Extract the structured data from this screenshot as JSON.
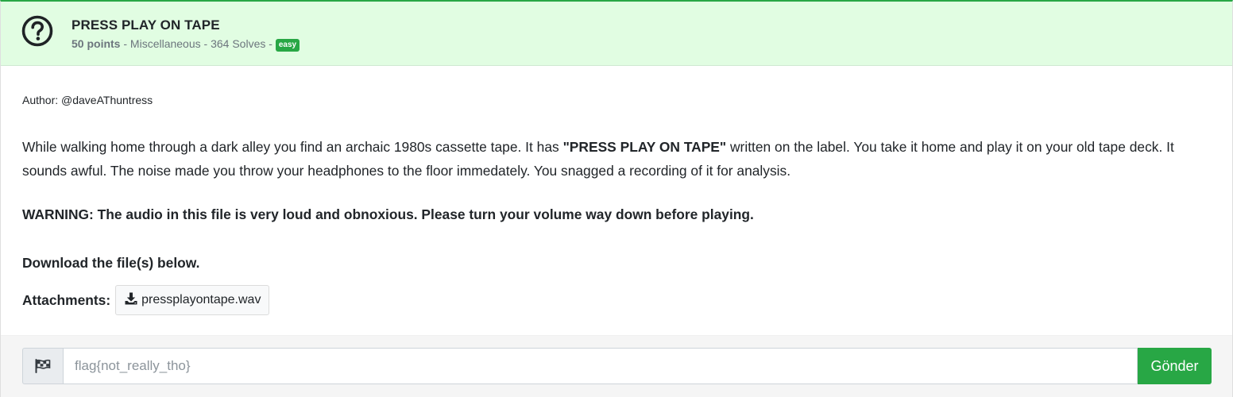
{
  "challenge": {
    "title": "PRESS PLAY ON TAPE",
    "points": "50 points",
    "separator1": " - ",
    "category": "Miscellaneous",
    "separator2": " - ",
    "solves": "364 Solves",
    "separator3": " - ",
    "difficulty": "easy",
    "icon": "question-circle-icon"
  },
  "body": {
    "author": "Author: @daveAThuntress",
    "description_part1": "While walking home through a dark alley you find an archaic 1980s cassette tape. It has ",
    "description_bold": "\"PRESS PLAY ON TAPE\"",
    "description_part2": " written on the label. You take it home and play it on your old tape deck. It sounds awful. The noise made you throw your headphones to the floor immedately. You snagged a recording of it for analysis.",
    "warning": "WARNING: The audio in this file is very loud and obnoxious. Please turn your volume way down before playing.",
    "download_note": "Download the file(s) below.",
    "attachments_label": "Attachments:",
    "attachments": [
      {
        "name": "pressplayontape.wav",
        "icon": "download-icon"
      }
    ]
  },
  "footer": {
    "flag_icon": "checkered-flag-icon",
    "flag_placeholder": "flag{not_really_tho}",
    "submit_label": "Gönder"
  },
  "colors": {
    "accent": "#28a745",
    "header_bg": "#e1fde2"
  }
}
